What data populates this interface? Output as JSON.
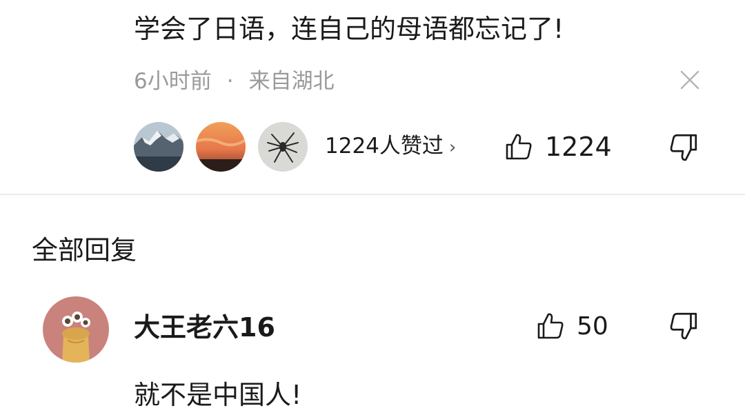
{
  "comment": {
    "text": "学会了日语，连自己的母语都忘记了!",
    "time": "6小时前",
    "separator": "·",
    "location": "来自湖北",
    "liked_by_label": "1224人赞过",
    "likes": "1224"
  },
  "replies_section": {
    "title": "全部回复"
  },
  "reply": {
    "username": "大王老六16",
    "likes": "50",
    "text": "就不是中国人!"
  },
  "icons": {
    "close": "close-icon",
    "like": "thumbs-up-icon",
    "dislike": "thumbs-down-icon",
    "chevron": "chevron-right-icon"
  },
  "colors": {
    "text": "#1a1a1a",
    "meta": "#9a9a9a",
    "divider": "#ececec"
  }
}
